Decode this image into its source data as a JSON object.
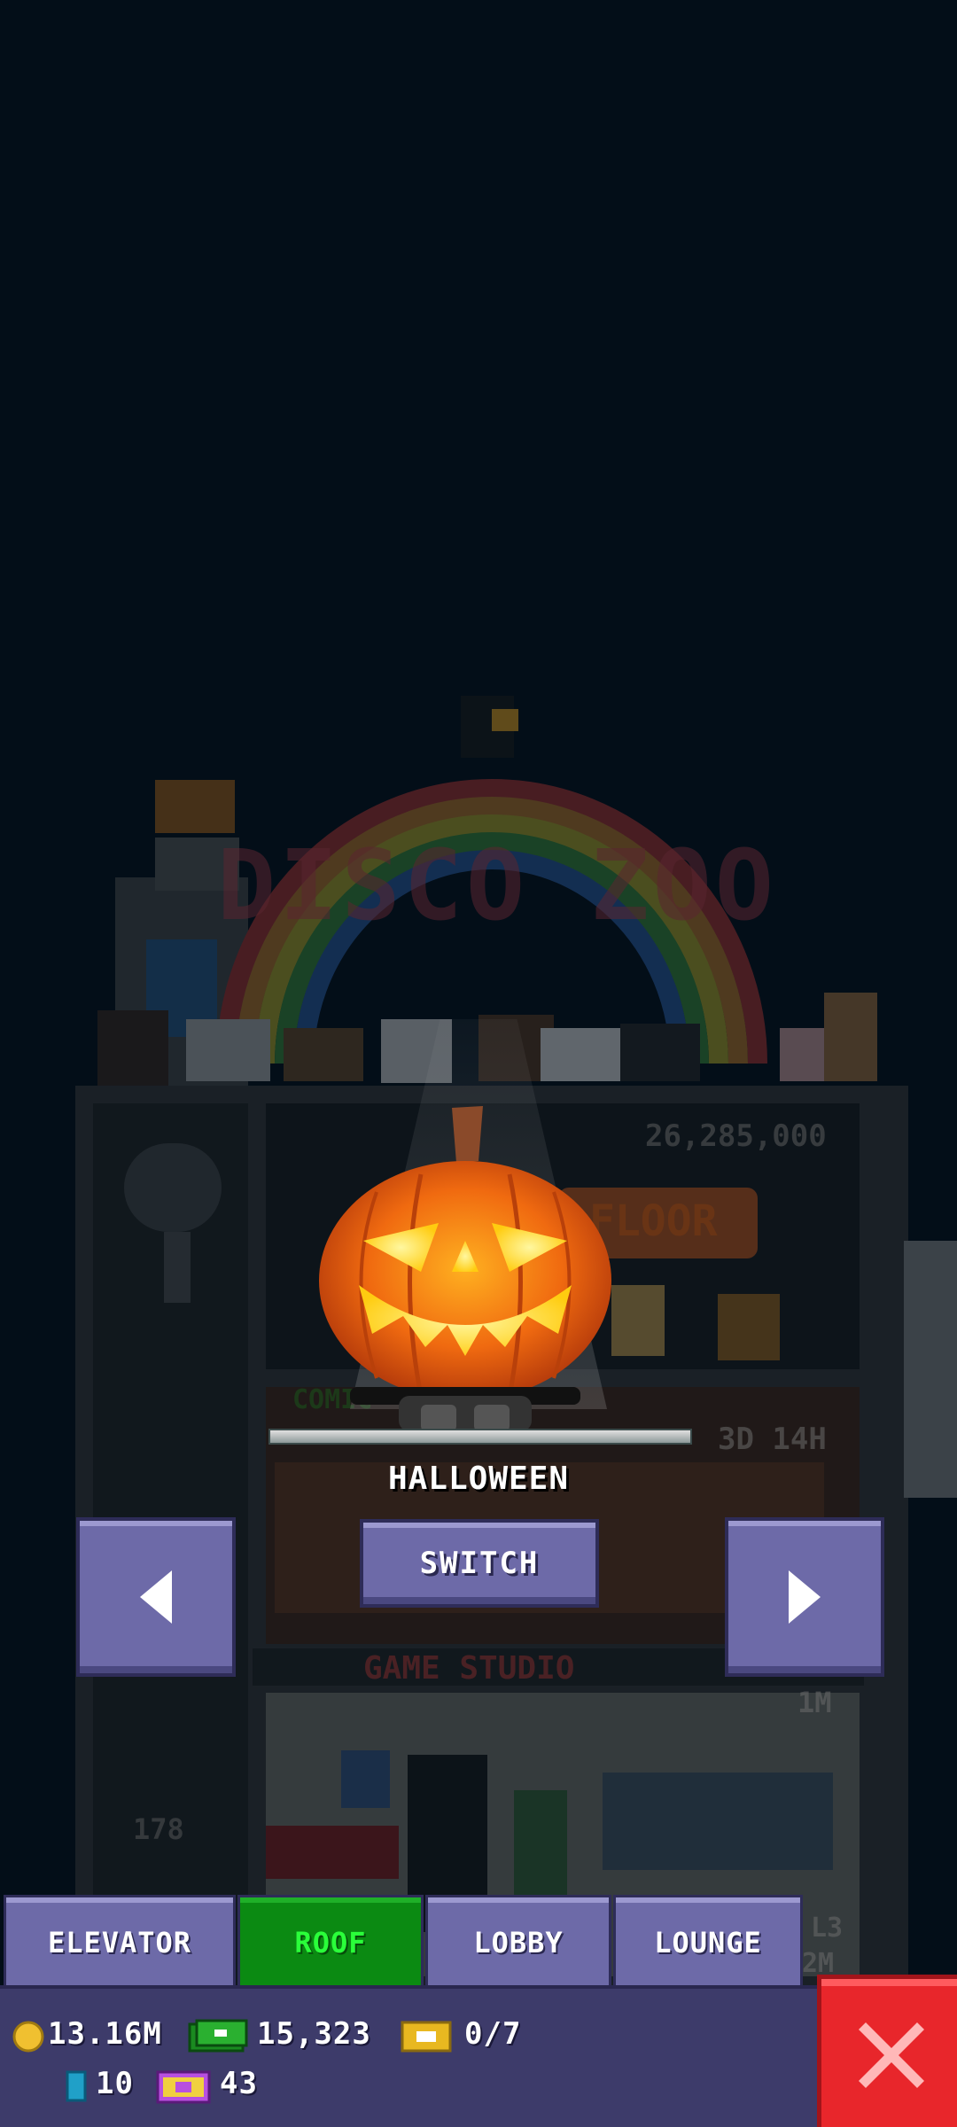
{
  "tower": {
    "sign_text": "DISCO ZOO",
    "floor_price": "26,285,000",
    "floor_button": "FLOOR",
    "floor_label": "COMIC",
    "timer": "3D 14H",
    "game_studio": "GAME STUDIO",
    "studio_value": "1M",
    "floor_number": "178",
    "side_level": "L3",
    "side_value": "2M"
  },
  "roof_item": {
    "name": "HALLOWEEN",
    "icon": "jack-o-lantern-icon"
  },
  "buttons": {
    "switch": "SWITCH",
    "prev_icon": "arrow-left-icon",
    "next_icon": "arrow-right-icon",
    "close_icon": "close-x-icon"
  },
  "tabs": [
    {
      "label": "ELEVATOR",
      "active": false
    },
    {
      "label": "ROOF",
      "active": true
    },
    {
      "label": "LOBBY",
      "active": false
    },
    {
      "label": "LOUNGE",
      "active": false
    }
  ],
  "stats": {
    "coins": "13.16M",
    "bux": "15,323",
    "tickets": "0/7",
    "cubes": "10",
    "golden_tickets": "43"
  },
  "colors": {
    "background": "#030e18",
    "button": "#6d6aa8",
    "active_tab": "#0b8a12",
    "active_tab_text": "#2aff3a",
    "close": "#e8262b",
    "status_bar": "#3d3b6a"
  }
}
